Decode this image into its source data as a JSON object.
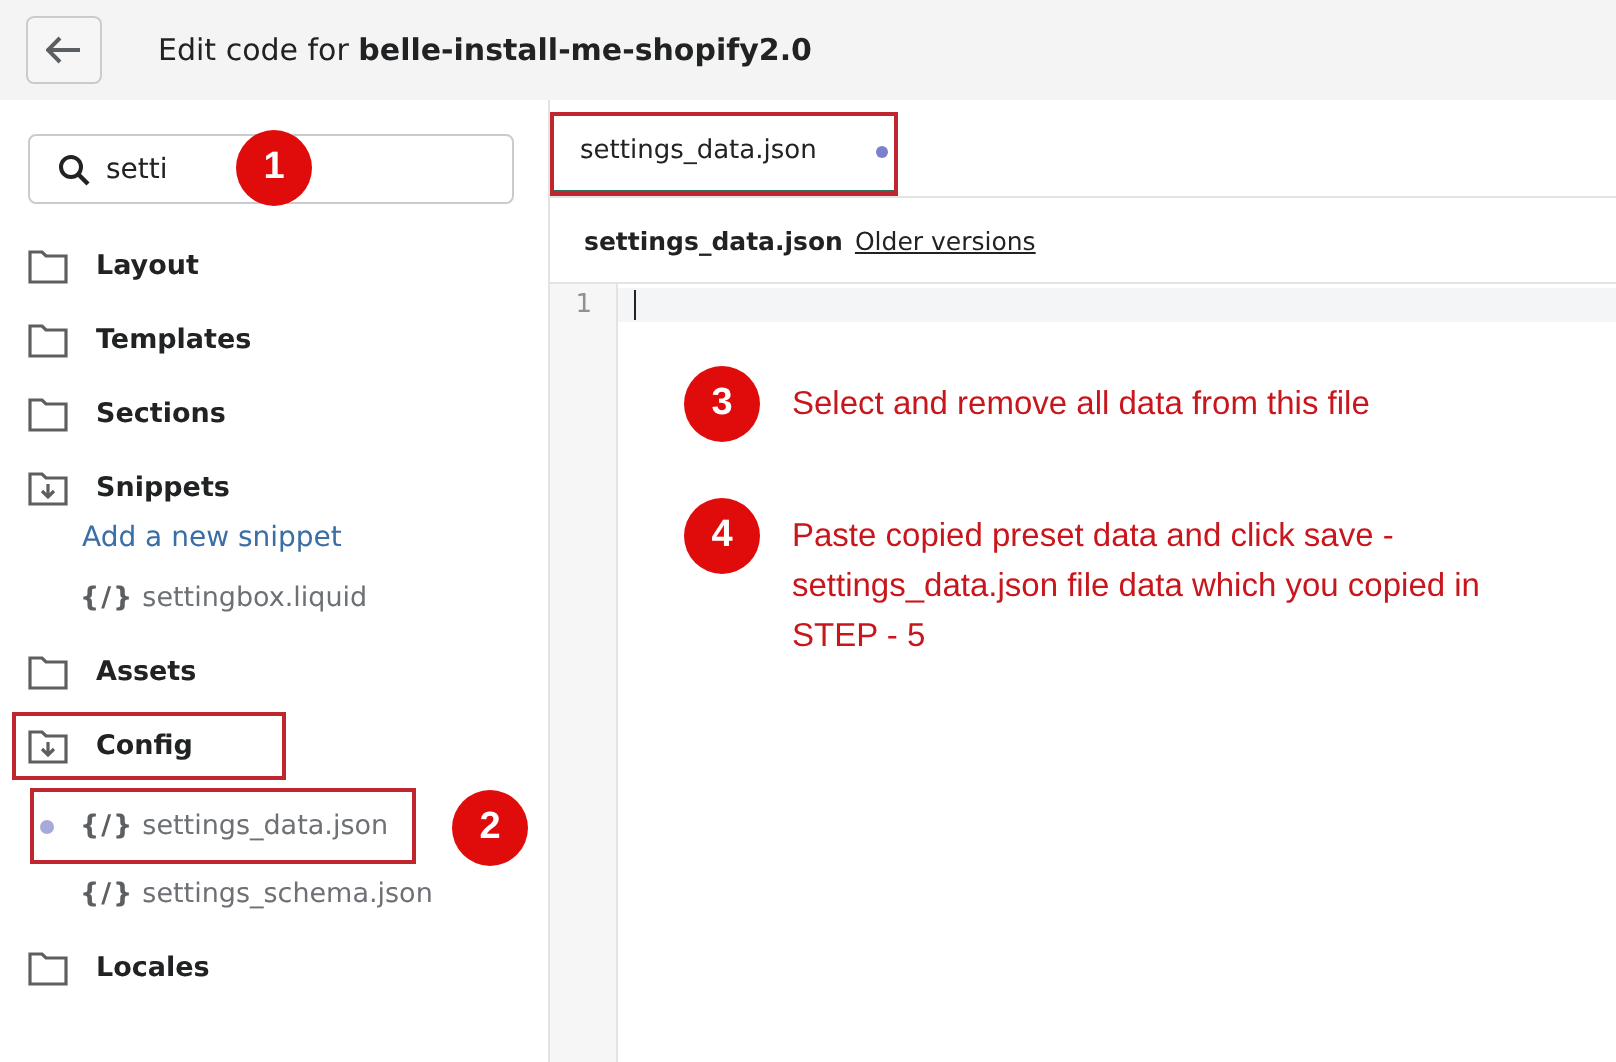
{
  "header": {
    "title_prefix": "Edit code for ",
    "theme_name": "belle-install-me-shopify2.0"
  },
  "search": {
    "value": "setti",
    "step": "1"
  },
  "tree": [
    {
      "label": "Layout",
      "expanded": false,
      "highlighted": false
    },
    {
      "label": "Templates",
      "expanded": false,
      "highlighted": false
    },
    {
      "label": "Sections",
      "expanded": false,
      "highlighted": false
    },
    {
      "label": "Snippets",
      "expanded": true,
      "highlighted": false,
      "children": [
        {
          "kind": "link",
          "label": "Add a new snippet"
        },
        {
          "kind": "file",
          "icon": "{/}",
          "label": "settingbox.liquid",
          "modified": false,
          "highlighted": false
        }
      ]
    },
    {
      "label": "Assets",
      "expanded": false,
      "highlighted": false
    },
    {
      "label": "Config",
      "expanded": true,
      "highlighted": true,
      "children": [
        {
          "kind": "file",
          "icon": "{/}",
          "label": "settings_data.json",
          "modified": true,
          "highlighted": true,
          "step": "2"
        },
        {
          "kind": "file",
          "icon": "{/}",
          "label": "settings_schema.json",
          "modified": false,
          "highlighted": false
        }
      ]
    },
    {
      "label": "Locales",
      "expanded": false,
      "highlighted": false
    }
  ],
  "tabs": [
    {
      "label": "settings_data.json",
      "modified": true,
      "selected": true,
      "highlighted": true
    }
  ],
  "editor": {
    "file_name": "settings_data.json",
    "history_link": "Older versions",
    "line_numbers": [
      "1"
    ]
  },
  "instructions": [
    {
      "step": "3",
      "text": "Select and remove all data from this file"
    },
    {
      "step": "4",
      "text": "Paste copied preset data and click save - settings_data.json file data which you copied in STEP - 5"
    }
  ]
}
